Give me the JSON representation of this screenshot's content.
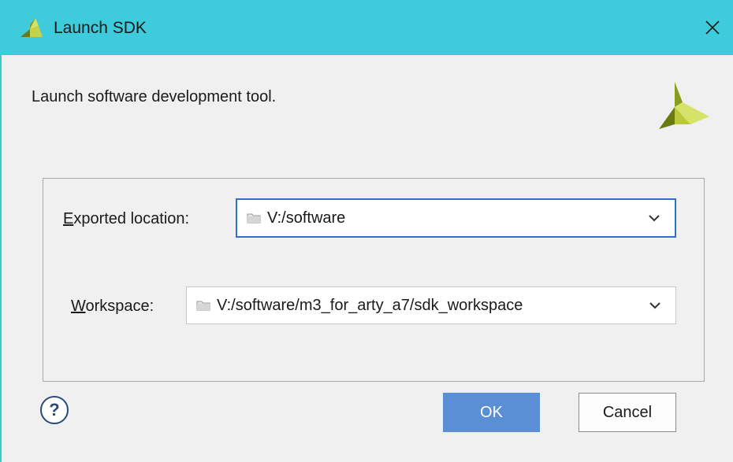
{
  "window": {
    "title": "Launch SDK",
    "close_glyph": "✕",
    "title_bar_color": "#3ecbdb",
    "logo_icon": "xilinx-logo-icon"
  },
  "description": "Launch software development tool.",
  "form": {
    "exported_location": {
      "label_mnemonic": "E",
      "label_rest": "xported location:",
      "value": "V:/software",
      "icon": "folder-icon"
    },
    "workspace": {
      "label_mnemonic": "W",
      "label_rest": "orkspace:",
      "value": "V:/software/m3_for_arty_a7/sdk_workspace",
      "icon": "folder-icon"
    }
  },
  "buttons": {
    "help_glyph": "?",
    "ok": "OK",
    "cancel": "Cancel",
    "ok_color": "#5a8fd6"
  }
}
